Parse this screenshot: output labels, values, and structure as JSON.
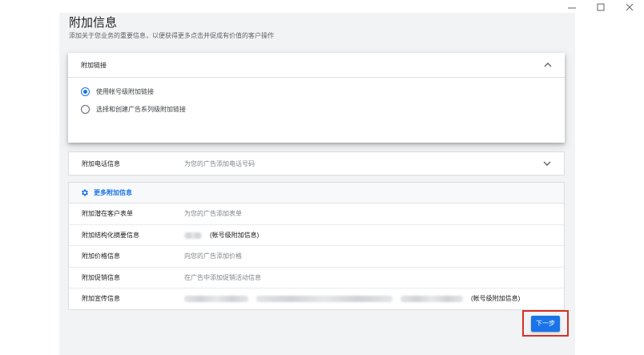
{
  "window": {
    "minimize": "–",
    "maximize": "□",
    "close": "✕"
  },
  "page": {
    "title": "附加信息",
    "subtitle": "添加关于您业务的重要信息，以便获得更多点击并促成有价值的客户操作"
  },
  "sitelinks": {
    "title": "附加链接",
    "options": [
      {
        "label": "使用帐号级附加链接",
        "selected": true
      },
      {
        "label": "选择和创建广告系列级附加链接",
        "selected": false
      }
    ]
  },
  "call": {
    "label": "附加电话信息",
    "desc": "为您的广告添加电话号码"
  },
  "more": {
    "title": "更多附加信息",
    "rows": [
      {
        "label": "附加潜在客户表单",
        "desc": "为您的广告添加表单"
      },
      {
        "label": "附加结构化摘要信息",
        "desc": "(帐号级附加信息)"
      },
      {
        "label": "附加价格信息",
        "desc": "向您的广告添加价格"
      },
      {
        "label": "附加促销信息",
        "desc": "在广告中添加促销活动信息"
      },
      {
        "label": "附加宣传信息",
        "desc": "(帐号级附加信息)"
      }
    ]
  },
  "actions": {
    "next": "下一步"
  },
  "colors": {
    "accent": "#1a73e8",
    "highlight": "#d93025",
    "panel": "#f1f3f4"
  }
}
